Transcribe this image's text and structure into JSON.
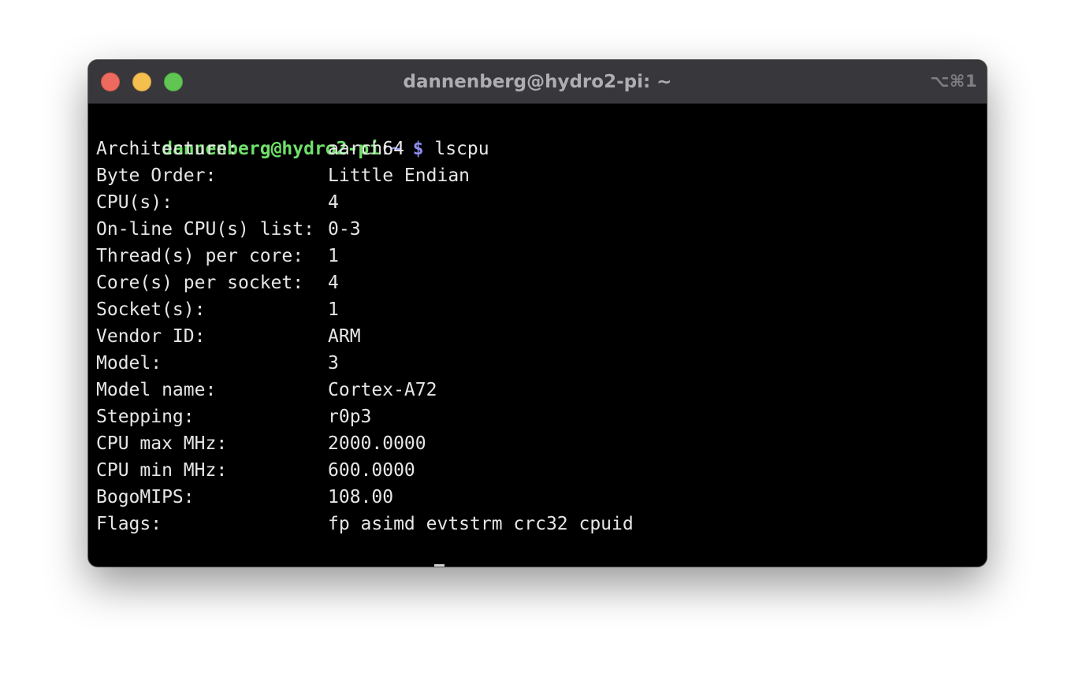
{
  "window": {
    "title": "dannenberg@hydro2-pi: ~",
    "shortcut": "⌥⌘1"
  },
  "colors": {
    "prompt_user": "#6fe06a",
    "prompt_path": "#8e8ff3",
    "text": "#e6e6e6",
    "background": "#000000",
    "titlebar": "#38373b"
  },
  "prompt": {
    "user_host": "dannenberg@hydro2-pi",
    "colon": ":",
    "path": "~",
    "dollar": "$"
  },
  "command": "lscpu",
  "output": [
    {
      "key": "Architecture:",
      "value": "aarch64"
    },
    {
      "key": "Byte Order:",
      "value": "Little Endian"
    },
    {
      "key": "CPU(s):",
      "value": "4"
    },
    {
      "key": "On-line CPU(s) list:",
      "value": "0-3"
    },
    {
      "key": "Thread(s) per core:",
      "value": "1"
    },
    {
      "key": "Core(s) per socket:",
      "value": "4"
    },
    {
      "key": "Socket(s):",
      "value": "1"
    },
    {
      "key": "Vendor ID:",
      "value": "ARM"
    },
    {
      "key": "Model:",
      "value": "3"
    },
    {
      "key": "Model name:",
      "value": "Cortex-A72"
    },
    {
      "key": "Stepping:",
      "value": "r0p3"
    },
    {
      "key": "CPU max MHz:",
      "value": "2000.0000"
    },
    {
      "key": "CPU min MHz:",
      "value": "600.0000"
    },
    {
      "key": "BogoMIPS:",
      "value": "108.00"
    },
    {
      "key": "Flags:",
      "value": "fp asimd evtstrm crc32 cpuid"
    }
  ]
}
